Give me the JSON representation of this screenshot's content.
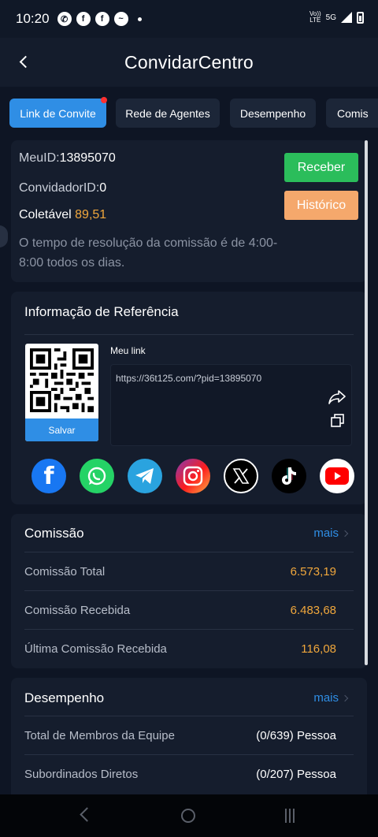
{
  "statusbar": {
    "time": "10:20",
    "left_icons": [
      "whatsapp-icon",
      "facebook-icon",
      "facebook-icon",
      "messenger-icon"
    ],
    "right_text_top": "Vo))",
    "right_text_bottom": "LTE",
    "network": "5G"
  },
  "header": {
    "title": "ConvidarCentro"
  },
  "tabs": [
    {
      "label": "Link de Convite",
      "active": true
    },
    {
      "label": "Rede de Agentes"
    },
    {
      "label": "Desempenho"
    },
    {
      "label": "Comis"
    }
  ],
  "account": {
    "meuid_label": "MeuID:",
    "meuid_value": "13895070",
    "convidador_label": "ConvidadorID:",
    "convidador_value": "0",
    "coletavel_label": "Coletável",
    "coletavel_value": "89,51",
    "receber_label": "Receber",
    "historico_label": "Histórico",
    "note": "O tempo de resolução da comissão é de 4:00-8:00 todos os dias."
  },
  "referral": {
    "title": "Informação de Referência",
    "save_label": "Salvar",
    "mylink_label": "Meu link",
    "link": "https://36t125.com/?pid=13895070",
    "socials": [
      {
        "name": "facebook",
        "color": "#1877f2"
      },
      {
        "name": "whatsapp",
        "color": "#25d366"
      },
      {
        "name": "telegram",
        "color": "#2aa3df"
      },
      {
        "name": "instagram",
        "color": "#d62976"
      },
      {
        "name": "x",
        "color": "#000000"
      },
      {
        "name": "tiktok",
        "color": "#000000"
      },
      {
        "name": "youtube",
        "color": "#ffffff"
      }
    ]
  },
  "commission": {
    "title": "Comissão",
    "more": "mais",
    "rows": [
      {
        "label": "Comissão Total",
        "value": "6.573,19"
      },
      {
        "label": "Comissão Recebida",
        "value": "6.483,68"
      },
      {
        "label": "Última Comissão Recebida",
        "value": "116,08"
      }
    ]
  },
  "performance": {
    "title": "Desempenho",
    "more": "mais",
    "rows": [
      {
        "label": "Total de Membros da Equipe",
        "value": "(0/639) Pessoa"
      },
      {
        "label": "Subordinados Diretos",
        "value": "(0/207) Pessoa"
      }
    ]
  },
  "colors": {
    "accent": "#2f8ee5",
    "green": "#2bbd5b",
    "orange": "#f5a86c",
    "gold": "#f0a73c"
  }
}
